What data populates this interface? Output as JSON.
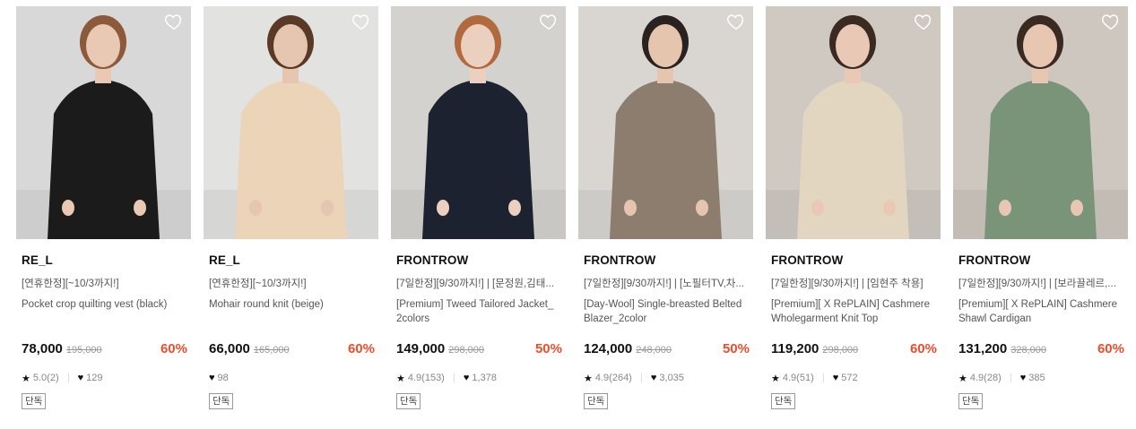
{
  "products": [
    {
      "brand": "RE_L",
      "promo": "[연휴한정][~10/3까지!]",
      "name": "Pocket crop quilting vest (black)",
      "sale_price": "78,000",
      "original_price": "195,000",
      "discount": "60%",
      "rating": "5.0(2)",
      "likes": "129",
      "badge": "단독",
      "colors": {
        "bg": "#d8d8d8",
        "garment": "#1b1b1b",
        "skin": "#e9c8b4",
        "hair": "#8a5a3a"
      }
    },
    {
      "brand": "RE_L",
      "promo": "[연휴한정][~10/3까지!]",
      "name": "Mohair round knit (beige)",
      "sale_price": "66,000",
      "original_price": "165,000",
      "discount": "60%",
      "rating": "",
      "likes": "98",
      "badge": "단독",
      "colors": {
        "bg": "#e2e2e0",
        "garment": "#ecd4b8",
        "skin": "#e6c6b0",
        "hair": "#5a3a26"
      }
    },
    {
      "brand": "FRONTROW",
      "promo": "[7일한정][9/30까지!] | [문정원,김태...",
      "name": "[Premium] Tweed Tailored Jacket_ 2colors",
      "sale_price": "149,000",
      "original_price": "298,000",
      "discount": "50%",
      "rating": "4.9(153)",
      "likes": "1,378",
      "badge": "단독",
      "colors": {
        "bg": "#d4d2cf",
        "garment": "#1d2230",
        "skin": "#ecd0bf",
        "hair": "#b06a3e"
      }
    },
    {
      "brand": "FRONTROW",
      "promo": "[7일한정][9/30까지!] | [노필터TV,차...",
      "name": "[Day-Wool] Single-breasted Belted Blazer_2color",
      "sale_price": "124,000",
      "original_price": "248,000",
      "discount": "50%",
      "rating": "4.9(264)",
      "likes": "3,035",
      "badge": "단독",
      "colors": {
        "bg": "#d9d6d2",
        "garment": "#8c7d6e",
        "skin": "#e6c5ae",
        "hair": "#2a2220"
      }
    },
    {
      "brand": "FRONTROW",
      "promo": "[7일한정][9/30까지!] | [임현주 착용]",
      "name": "[Premium][ X RePLAIN] Cashmere Wholegarment Knit Top",
      "sale_price": "119,200",
      "original_price": "298,000",
      "discount": "60%",
      "rating": "4.9(51)",
      "likes": "572",
      "badge": "단독",
      "colors": {
        "bg": "#cfc9c2",
        "garment": "#e3d6c0",
        "skin": "#e9c9b6",
        "hair": "#3b2a22"
      }
    },
    {
      "brand": "FRONTROW",
      "promo": "[7일한정][9/30까지!] | [보라끌레르,...",
      "name": "[Premium][ X RePLAIN] Cashmere Shawl Cardigan",
      "sale_price": "131,200",
      "original_price": "328,000",
      "discount": "60%",
      "rating": "4.9(28)",
      "likes": "385",
      "badge": "단독",
      "colors": {
        "bg": "#cdc7bf",
        "garment": "#7a9479",
        "skin": "#e7c6b2",
        "hair": "#3a2a22"
      }
    }
  ],
  "icons": {
    "wishlist": "heart-outline-icon",
    "rating": "star-icon",
    "likes": "heart-filled-icon"
  }
}
